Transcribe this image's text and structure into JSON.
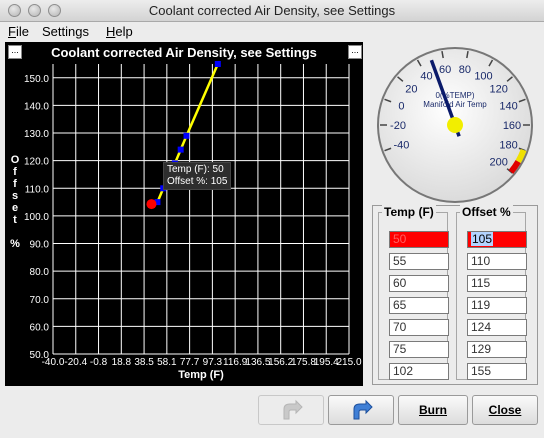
{
  "window": {
    "title": "Coolant corrected Air Density, see Settings"
  },
  "menu": {
    "items": [
      {
        "mnemonic": "F",
        "rest": "ile"
      },
      {
        "mnemonic": "",
        "rest": "Settings"
      },
      {
        "mnemonic": "H",
        "rest": "elp"
      }
    ]
  },
  "chart": {
    "title": "Coolant corrected Air Density, see Settings",
    "ylabel_letters": "O\nf\nf\ns\ne\nt\n\n%",
    "xlabel": "Temp (F)",
    "mini_button": "...",
    "tooltip_line1": "Temp (F): 50",
    "tooltip_line2": "Offset %: 105"
  },
  "chart_data": {
    "type": "line",
    "title": "Coolant corrected Air Density, see Settings",
    "xlabel": "Temp (F)",
    "ylabel": "Offset %",
    "x_ticks": [
      "-40.0",
      "-20.4",
      "-0.8",
      "18.8",
      "38.5",
      "58.1",
      "77.7",
      "97.3",
      "116.9",
      "136.5",
      "156.2",
      "175.8",
      "195.4",
      "215.0"
    ],
    "y_ticks": [
      "50.0",
      "60.0",
      "70.0",
      "80.0",
      "90.0",
      "100.0",
      "110.0",
      "120.0",
      "130.0",
      "140.0",
      "150.0"
    ],
    "xlim": [
      -40,
      215
    ],
    "ylim": [
      50,
      155
    ],
    "grid": true,
    "series": [
      {
        "points": [
          [
            50,
            105
          ],
          [
            55,
            110
          ],
          [
            60,
            115
          ],
          [
            65,
            119
          ],
          [
            70,
            124
          ],
          [
            75,
            129
          ],
          [
            102,
            155
          ]
        ]
      }
    ],
    "selected_point": [
      50,
      105
    ],
    "colors": {
      "line": "#ffff00",
      "point": "#0000ff",
      "selected": "#ff0000",
      "grid": "#ffffff"
    }
  },
  "gauge": {
    "center_label": "0(%TEMP)",
    "title": "Manifold Air Temp",
    "ticks": [
      "-40",
      "-20",
      "0",
      "20",
      "40",
      "60",
      "80",
      "100",
      "120",
      "140",
      "160",
      "180",
      "200"
    ],
    "value": 50
  },
  "table": {
    "temp_header": "Temp (F)",
    "offset_header": "Offset %",
    "temps": [
      "50",
      "55",
      "60",
      "65",
      "70",
      "75",
      "102"
    ],
    "offsets": [
      "105",
      "110",
      "115",
      "119",
      "124",
      "129",
      "155"
    ]
  },
  "buttons": {
    "undo_label": "",
    "redo_label": "",
    "burn_label": "Burn",
    "close_label": "Close"
  }
}
